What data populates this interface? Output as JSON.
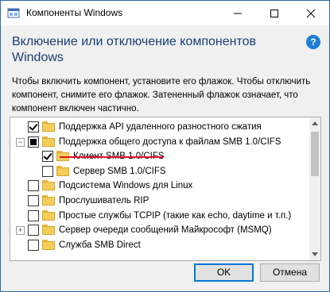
{
  "window": {
    "title": "Компоненты Windows"
  },
  "header": {
    "title": "Включение или отключение компонентов Windows",
    "help_icon": "?"
  },
  "description": "Чтобы включить компонент, установите его флажок. Чтобы отключить компонент, снимите его флажок. Затененный флажок означает, что компонент включен частично.",
  "tree": {
    "items": [
      {
        "label": "Поддержка API удаленного разностного сжатия",
        "state": "checked",
        "expander": "",
        "level": 0
      },
      {
        "label": "Поддержка общего доступа к файлам SMB 1.0/CIFS",
        "state": "partial",
        "expander": "−",
        "level": 0
      },
      {
        "label": "Клиент SMB 1.0/CIFS",
        "state": "checked",
        "expander": "",
        "level": 1,
        "highlighted": true
      },
      {
        "label": "Сервер SMB 1.0/CIFS",
        "state": "unchecked",
        "expander": "",
        "level": 1
      },
      {
        "label": "Подсистема Windows для Linux",
        "state": "unchecked",
        "expander": "",
        "level": 0
      },
      {
        "label": "Прослушиватель RIP",
        "state": "unchecked",
        "expander": "",
        "level": 0
      },
      {
        "label": "Простые службы TCPIP (такие как echo, daytime и т.п.)",
        "state": "unchecked",
        "expander": "",
        "level": 0
      },
      {
        "label": "Сервер очереди сообщений Майкрософт (MSMQ)",
        "state": "unchecked",
        "expander": "+",
        "level": 0
      },
      {
        "label": "Служба SMB Direct",
        "state": "unchecked",
        "expander": "",
        "level": 0
      }
    ]
  },
  "buttons": {
    "ok": "OK",
    "cancel": "Отмена"
  },
  "colors": {
    "header_title": "#1a3d78",
    "accent": "#0078d7",
    "highlight_underline": "#e8102a"
  }
}
